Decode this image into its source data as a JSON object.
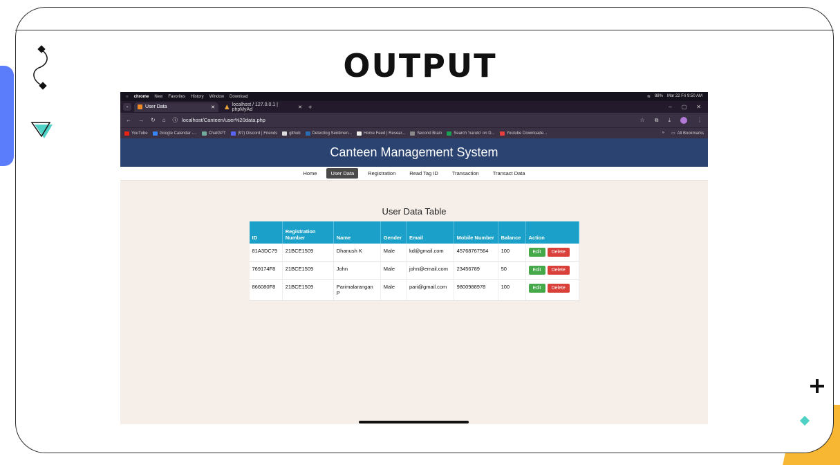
{
  "slide": {
    "title": "OUTPUT"
  },
  "decorations": {
    "icons": [
      "squiggle-icon",
      "triangle-icon",
      "plus-icon",
      "diamond-icon"
    ],
    "colors": {
      "blue": "#5b7cfb",
      "yellow": "#f7b733",
      "teal": "#4fd1c5"
    }
  },
  "mac_menu": {
    "app": "chrome",
    "items": [
      "New",
      "Favorites",
      "History",
      "Window",
      "Download"
    ],
    "status_right": [
      "88%",
      "Mar 22 Fri 9:50 AM"
    ]
  },
  "tabs": [
    {
      "label": "User Data",
      "active": true
    },
    {
      "label": "localhost / 127.0.0.1 | phpMyAd",
      "active": false
    }
  ],
  "address_bar": {
    "url": "localhost/Canteen/user%20data.php"
  },
  "bookmarks": {
    "items": [
      "YouTube",
      "Google Calendar -...",
      "ChatGPT",
      "(97) Discord | Friends",
      "github",
      "Detecting Sentimen...",
      "Home Feed | Resear...",
      "Second Brain",
      "Search 'naruto' on D...",
      "Youtube Downloade..."
    ],
    "more": "»",
    "all": "All Bookmarks"
  },
  "app": {
    "title": "Canteen Management System",
    "nav": [
      "Home",
      "User Data",
      "Registration",
      "Read Tag ID",
      "Transaction",
      "Transact Data"
    ],
    "active_nav": "User Data"
  },
  "table": {
    "title": "User Data Table",
    "headers": [
      "ID",
      "Registration Number",
      "Name",
      "Gender",
      "Email",
      "Mobile Number",
      "Balance",
      "Action"
    ],
    "rows": [
      [
        "81A3DC79",
        "21BCE1509",
        "Dhanush K",
        "Male",
        "kd@gmail.com",
        "45768767564",
        "100"
      ],
      [
        "769174F8",
        "21BCE1509",
        "John",
        "Male",
        "john@email.com",
        "23456789",
        "50"
      ],
      [
        "866080F8",
        "21BCE1509",
        "Parimalarangan P",
        "Male",
        "pari@gmail.com",
        "9800988978",
        "100"
      ]
    ],
    "edit_label": "Edit",
    "delete_label": "Delete",
    "colors": {
      "header": "#1aa0c9",
      "edit": "#45a94a",
      "delete": "#d9403a"
    }
  },
  "colors": {
    "app_header": "#2a4370",
    "page_bg": "#f6efe9"
  }
}
